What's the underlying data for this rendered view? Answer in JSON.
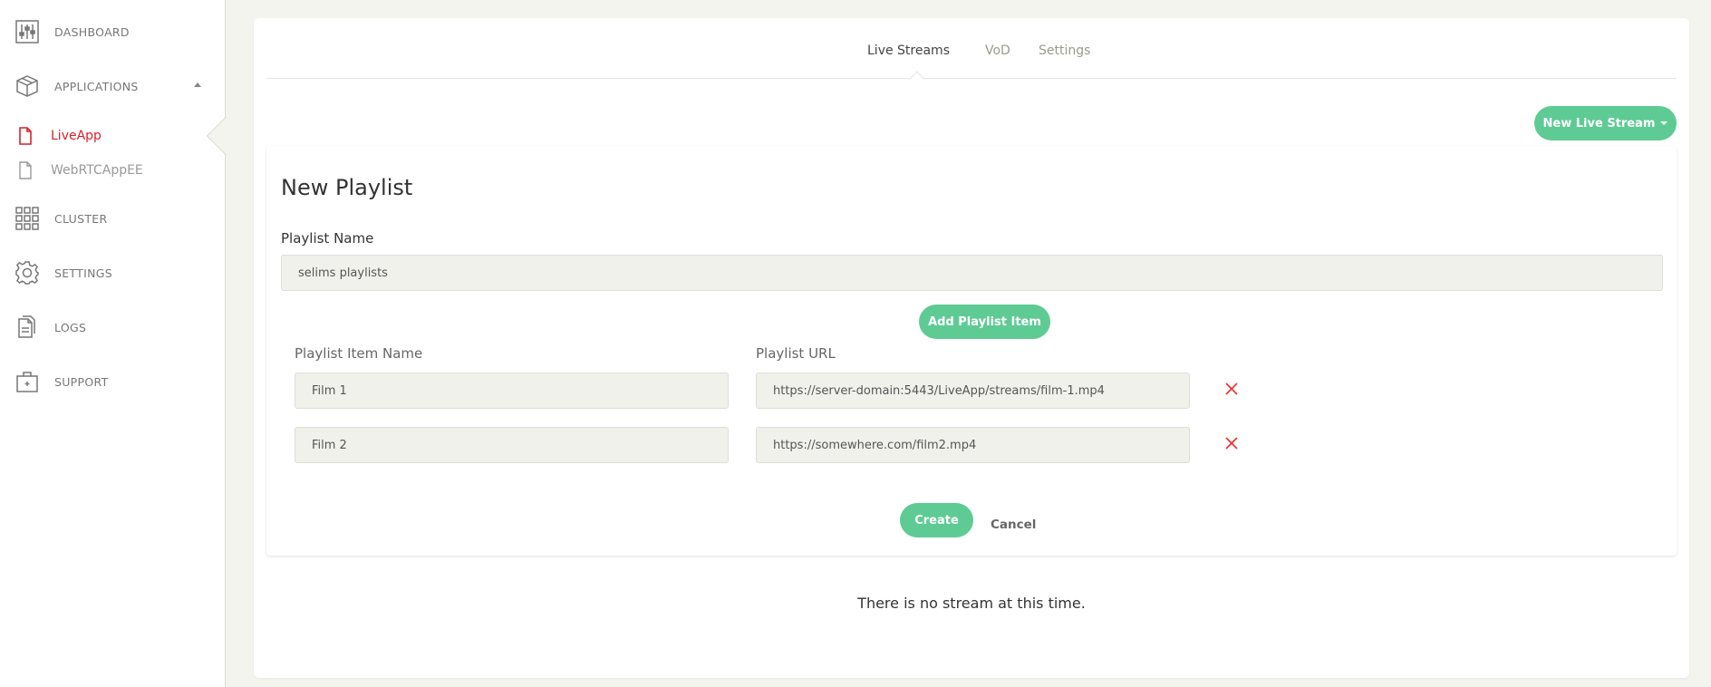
{
  "sidebar": {
    "items": [
      {
        "label": "DASHBOARD",
        "icon": "sliders-icon"
      },
      {
        "label": "APPLICATIONS",
        "icon": "package-icon"
      },
      {
        "label": "CLUSTER",
        "icon": "grid-icon"
      },
      {
        "label": "SETTINGS",
        "icon": "gear-icon"
      },
      {
        "label": "LOGS",
        "icon": "files-icon"
      },
      {
        "label": "SUPPORT",
        "icon": "briefcase-icon"
      }
    ],
    "apps": [
      {
        "label": "LiveApp",
        "active": true
      },
      {
        "label": "WebRTCAppEE",
        "active": false
      }
    ]
  },
  "tabs": [
    {
      "label": "Live Streams"
    },
    {
      "label": "VoD"
    },
    {
      "label": "Settings"
    }
  ],
  "toolbar": {
    "new_stream_label": "New Live Stream"
  },
  "playlist": {
    "title": "New Playlist",
    "name_label": "Playlist Name",
    "name_value": "selims playlists",
    "add_item_label": "Add Playlist Item",
    "item_name_header": "Playlist Item Name",
    "item_url_header": "Playlist URL",
    "items": [
      {
        "name": "Film 1",
        "url": "https://server-domain:5443/LiveApp/streams/film-1.mp4"
      },
      {
        "name": "Film 2",
        "url": "https://somewhere.com/film2.mp4"
      }
    ],
    "create_label": "Create",
    "cancel_label": "Cancel"
  },
  "empty_message": "There is no stream at this time.",
  "colors": {
    "accent": "#5ecb94",
    "active": "#d9202a",
    "remove": "#e53935"
  }
}
